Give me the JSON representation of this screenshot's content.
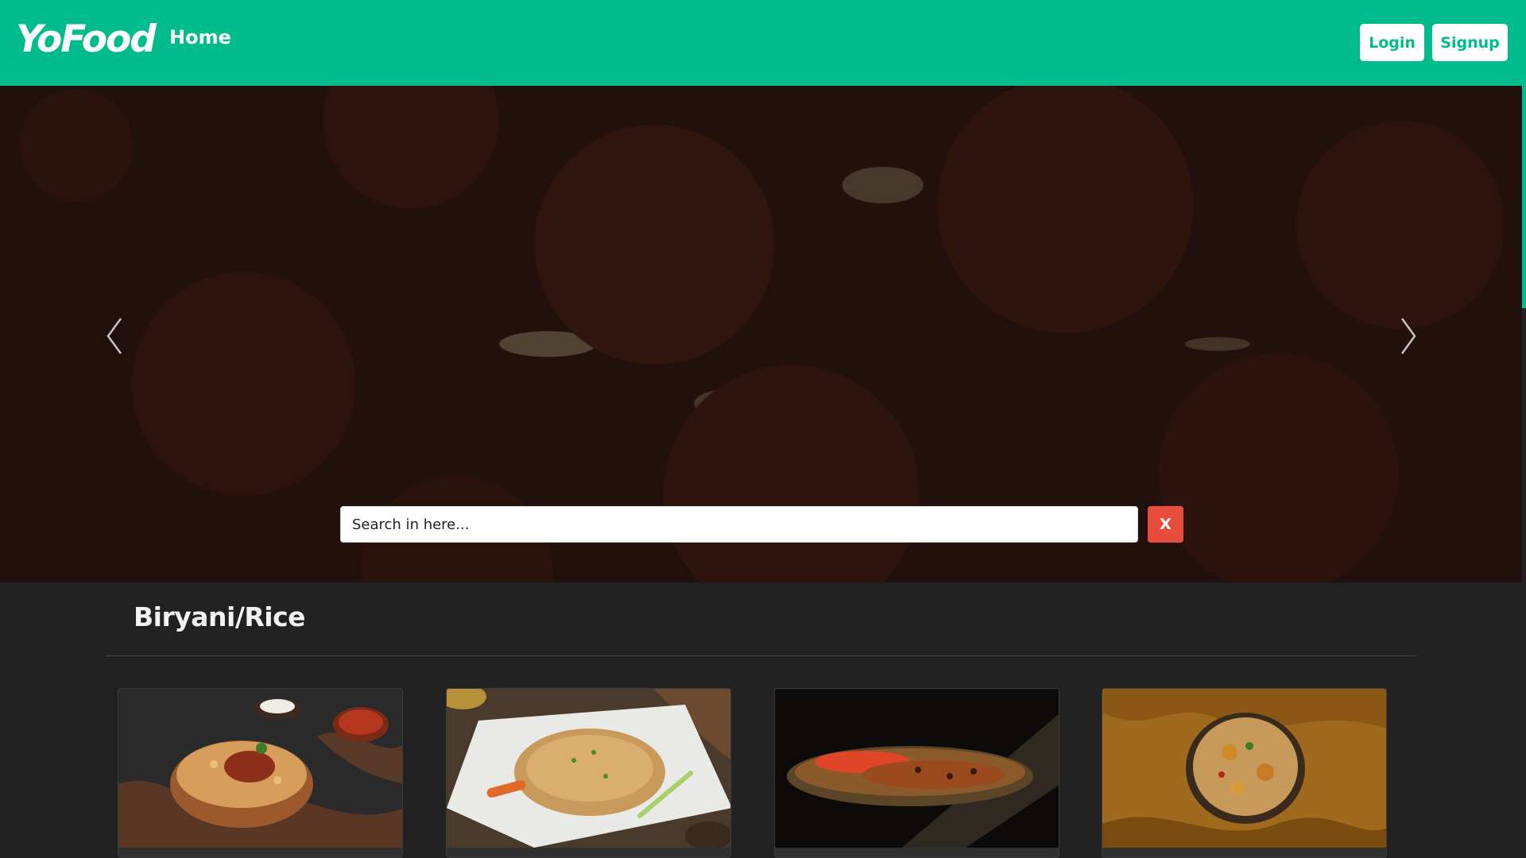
{
  "navbar": {
    "brand": "YoFood",
    "home_link": "Home",
    "login_label": "Login",
    "signup_label": "Signup",
    "background_color": "#00bc8c"
  },
  "hero": {
    "carousel_prev_icon": "chevron-left-icon",
    "carousel_next_icon": "chevron-right-icon",
    "search": {
      "placeholder": "Search in here...",
      "value": "",
      "clear_label": "X",
      "clear_color": "#e74c3c"
    }
  },
  "category": {
    "title": "Biryani/Rice",
    "cards": [
      {
        "image": "chicken-biryani-copper-bowl"
      },
      {
        "image": "veg-fried-rice-plate"
      },
      {
        "image": "rice-dish-oval-platter"
      },
      {
        "image": "biryani-bowl-mustard-cloth"
      }
    ]
  }
}
